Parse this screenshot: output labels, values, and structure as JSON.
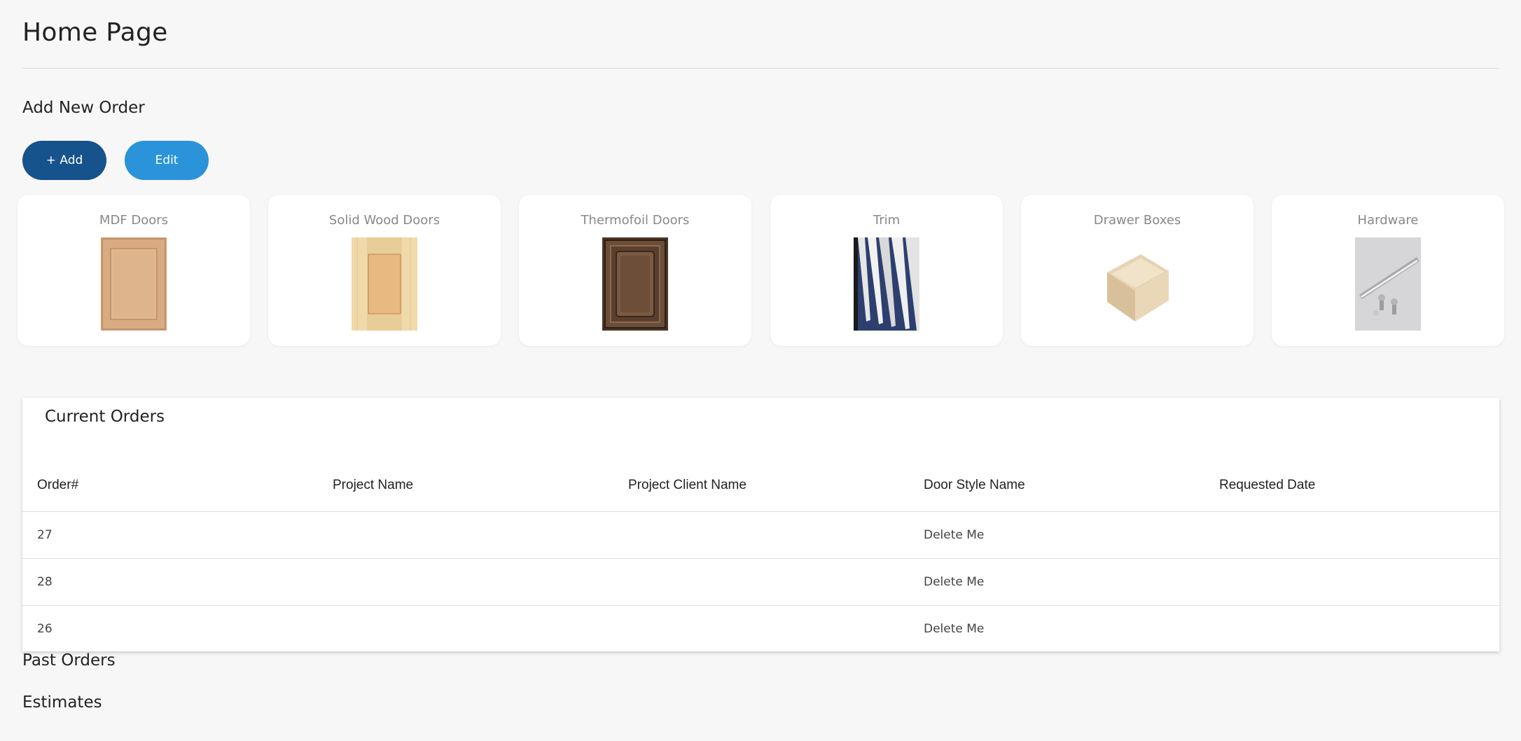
{
  "page": {
    "title": "Home Page"
  },
  "add_new_order": {
    "heading": "Add New Order",
    "add_label": "+ Add",
    "edit_label": "Edit"
  },
  "categories": [
    {
      "label": "MDF Doors",
      "icon": "mdf-door-image"
    },
    {
      "label": "Solid Wood Doors",
      "icon": "solid-wood-door-image"
    },
    {
      "label": "Thermofoil Doors",
      "icon": "thermofoil-door-image"
    },
    {
      "label": "Trim",
      "icon": "trim-image"
    },
    {
      "label": "Drawer Boxes",
      "icon": "drawer-box-image"
    },
    {
      "label": "Hardware",
      "icon": "hardware-image"
    }
  ],
  "current_orders": {
    "title": "Current Orders",
    "columns": [
      "Order#",
      "Project Name",
      "Project Client Name",
      "Door Style Name",
      "Requested Date"
    ],
    "rows": [
      {
        "order": "27",
        "project_name": "",
        "client_name": "",
        "door_style": "Delete Me",
        "requested_date": ""
      },
      {
        "order": "28",
        "project_name": "",
        "client_name": "",
        "door_style": "Delete Me",
        "requested_date": ""
      },
      {
        "order": "26",
        "project_name": "",
        "client_name": "",
        "door_style": "Delete Me",
        "requested_date": ""
      }
    ]
  },
  "past_orders": {
    "heading": "Past Orders"
  },
  "estimates": {
    "heading": "Estimates"
  },
  "colors": {
    "background": "#f7f7f7",
    "add_button": "#16528c",
    "edit_button": "#2a93d9",
    "card": "#ffffff"
  }
}
